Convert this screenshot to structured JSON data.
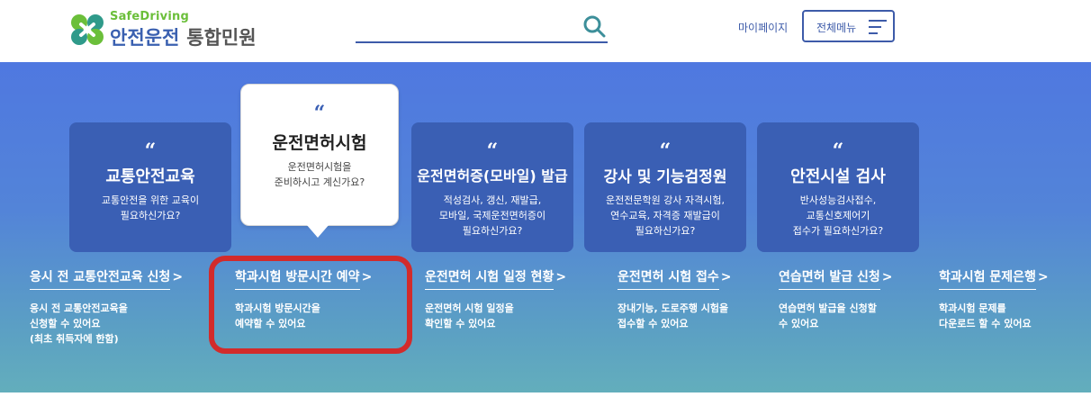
{
  "header": {
    "logo": {
      "en": "SafeDriving",
      "ko": "안전운전",
      "sub": "통합민원"
    },
    "search": {
      "value": "",
      "placeholder": ""
    },
    "mypage_label": "마이페이지",
    "menu_label": "전체메뉴"
  },
  "colors": {
    "primary": "#3d5ba9",
    "card_bg": "#3a5fb4",
    "logo_green": "#6bbf3a",
    "highlight_red": "#d22b2b",
    "banner_top": "#4f78e0",
    "banner_bottom": "#63aebc"
  },
  "cards": [
    {
      "quote": "“",
      "title": "교통안전교육",
      "desc": [
        "교통안전을 위한 교육이",
        "필요하신가요?"
      ]
    },
    {
      "quote": "“",
      "title": "운전면허시험",
      "desc": [
        "운전면허시험을",
        "준비하시고 계신가요?"
      ],
      "active": true
    },
    {
      "quote": "“",
      "title": "운전면허증(모바일) 발급",
      "desc": [
        "적성검사, 갱신, 재발급,",
        "모바일, 국제운전면허증이",
        "필요하신가요?"
      ]
    },
    {
      "quote": "“",
      "title": "강사 및 기능검정원",
      "desc": [
        "운전전문학원 강사 자격시험,",
        "연수교육, 자격증 재발급이",
        "필요하신가요?"
      ]
    },
    {
      "quote": "“",
      "title": "안전시설 검사",
      "desc": [
        "반사성능검사접수,",
        "교통신호제어기",
        "접수가 필요하신가요?"
      ]
    }
  ],
  "links": [
    {
      "title": "응시 전 교통안전교육 신청",
      "arrow": ">",
      "desc": [
        "응시 전 교통안전교육을",
        "신청할 수 있어요",
        "(최초 취득자에 한함)"
      ]
    },
    {
      "title": "학과시험 방문시간 예약",
      "arrow": ">",
      "desc": [
        "학과시험 방문시간을",
        "예약할 수 있어요"
      ]
    },
    {
      "title": "운전면허 시험 일정 현황",
      "arrow": ">",
      "desc": [
        "운전면허 시험 일정을",
        "확인할 수 있어요"
      ]
    },
    {
      "title": "운전면허 시험 접수",
      "arrow": ">",
      "desc": [
        "장내기능, 도로주행 시험을",
        "접수할 수 있어요"
      ]
    },
    {
      "title": "연습면허 발급 신청",
      "arrow": ">",
      "desc": [
        "연습면허 발급을 신청할",
        "수 있어요"
      ]
    },
    {
      "title": "학과시험 문제은행",
      "arrow": ">",
      "desc": [
        "학과시험 문제를",
        "다운로드 할 수 있어요"
      ]
    }
  ]
}
